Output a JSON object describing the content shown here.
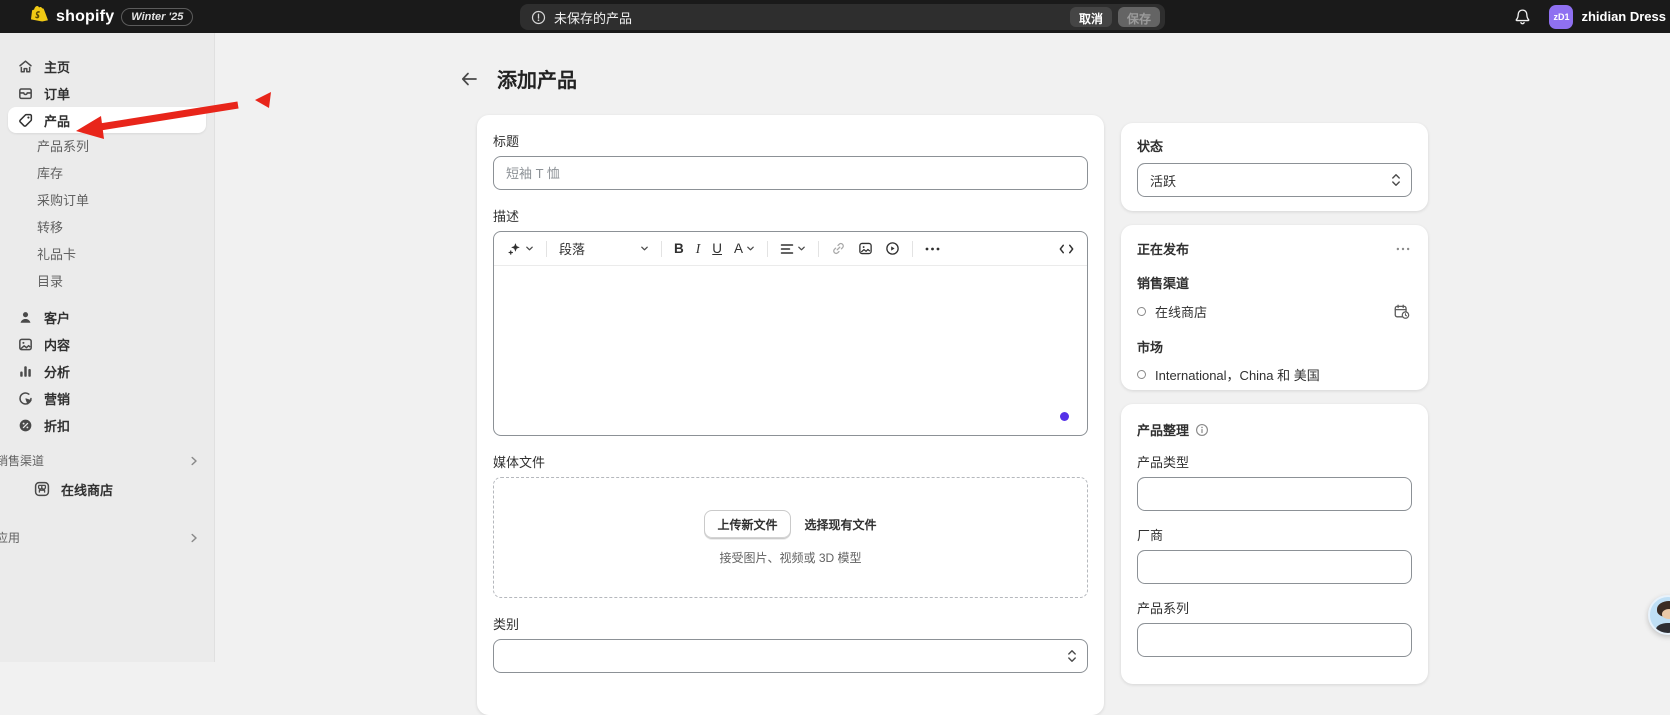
{
  "topbar": {
    "brand": "shopify",
    "version_badge": "Winter '25",
    "save_bar": {
      "message": "未保存的产品",
      "cancel_label": "取消",
      "save_label": "保存"
    },
    "user": {
      "initials": "zD1",
      "name": "zhidian Dress"
    }
  },
  "sidebar": {
    "items": [
      {
        "label": "主页"
      },
      {
        "label": "订单"
      },
      {
        "label": "产品"
      },
      {
        "label": "产品系列"
      },
      {
        "label": "库存"
      },
      {
        "label": "采购订单"
      },
      {
        "label": "转移"
      },
      {
        "label": "礼品卡"
      },
      {
        "label": "目录"
      },
      {
        "label": "客户"
      },
      {
        "label": "内容"
      },
      {
        "label": "分析"
      },
      {
        "label": "营销"
      },
      {
        "label": "折扣"
      }
    ],
    "sales_channels_section": "销售渠道",
    "online_store": "在线商店",
    "apps_section": "应用"
  },
  "main": {
    "page_title": "添加产品",
    "title_field": {
      "label": "标题",
      "placeholder": "短袖 T 恤"
    },
    "description_field": {
      "label": "描述",
      "toolbar": {
        "paragraph": "段落",
        "bold": "B",
        "italic": "I",
        "underline": "U",
        "color": "A"
      }
    },
    "media": {
      "label": "媒体文件",
      "upload_button": "上传新文件",
      "select_button": "选择现有文件",
      "hint": "接受图片、视频或 3D 模型"
    },
    "category": {
      "label": "类别"
    }
  },
  "right_panel": {
    "status": {
      "label": "状态",
      "value": "活跃"
    },
    "publishing": {
      "title": "正在发布",
      "sales_channels_label": "销售渠道",
      "channel": "在线商店",
      "markets_label": "市场",
      "markets_value": "International，China 和 美国"
    },
    "organization": {
      "title": "产品整理",
      "product_type_label": "产品类型",
      "vendor_label": "厂商",
      "collections_label": "产品系列"
    }
  },
  "colors": {
    "topbar_bg": "#1a1a1a",
    "avatar_purple": "#8f70f1",
    "logo_yellow": "#f0c914",
    "annotation_red": "#e8251a",
    "magic_dot": "#5531e8"
  }
}
